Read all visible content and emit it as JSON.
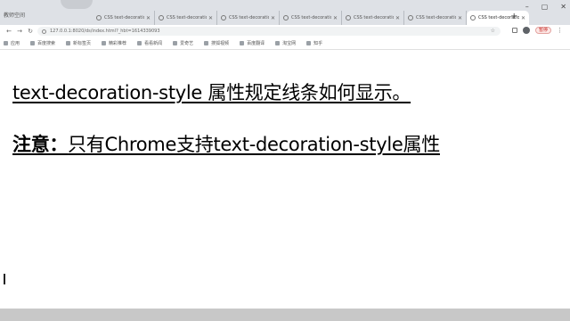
{
  "browser": {
    "app_label": "教师空间",
    "tabs": [
      {
        "title": "CSS text-decoratio",
        "active": false
      },
      {
        "title": "CSS text-decoratio",
        "active": false
      },
      {
        "title": "CSS text-decoratio",
        "active": false
      },
      {
        "title": "CSS text-decoratio",
        "active": false
      },
      {
        "title": "CSS text-decoratio",
        "active": false
      },
      {
        "title": "CSS text-decoratio",
        "active": false
      },
      {
        "title": "CSS text-decoratio",
        "active": true
      }
    ],
    "address": {
      "url": "127.0.0.1:8020/ds/index.html?_hbt=1614339093"
    },
    "pause_label": "暂停",
    "bookmarks": [
      "应用",
      "百度搜索",
      "新标签页",
      "精彩推荐",
      "看看新闻",
      "爱奇艺",
      "搜狐视频",
      "百度翻译",
      "淘宝网",
      "知乎"
    ]
  },
  "page": {
    "line1": "text-decoration-style 属性规定线条如何显示。",
    "note_label": "注意：",
    "note_text": "只有Chrome支持text-decoration-style属性"
  }
}
